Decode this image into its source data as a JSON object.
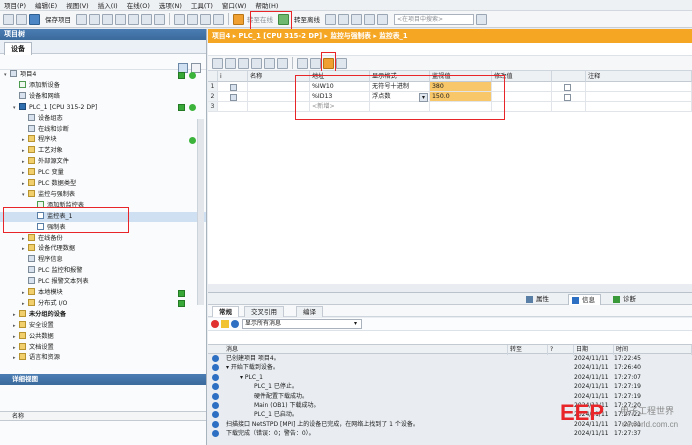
{
  "menubar": [
    "项目(P)",
    "编辑(E)",
    "视图(V)",
    "插入(I)",
    "在线(O)",
    "选项(N)",
    "工具(T)",
    "窗口(W)",
    "帮助(H)"
  ],
  "toolbar": {
    "save_label": "保存项目",
    "go_online_label": "转至在线",
    "go_offline_label": "转至离线",
    "search_placeholder": "<在项目中搜索>"
  },
  "left": {
    "header": "项目树",
    "tab": "设备",
    "tree": [
      {
        "label": "项目4",
        "indent": 0,
        "icon": "project",
        "twisty": "▾",
        "status": "check-dot"
      },
      {
        "label": "添加新设备",
        "indent": 1,
        "icon": "add"
      },
      {
        "label": "设备和网络",
        "indent": 1,
        "icon": "network"
      },
      {
        "label": "PLC_1 [CPU 315-2 DP]",
        "indent": 1,
        "icon": "cpu",
        "twisty": "▾",
        "status": "check-dot"
      },
      {
        "label": "设备组态",
        "indent": 2,
        "icon": "device"
      },
      {
        "label": "在线和诊断",
        "indent": 2,
        "icon": "diag"
      },
      {
        "label": "程序块",
        "indent": 2,
        "icon": "folder",
        "twisty": "▸",
        "status": "dot"
      },
      {
        "label": "工艺对象",
        "indent": 2,
        "icon": "folder",
        "twisty": "▸"
      },
      {
        "label": "外部源文件",
        "indent": 2,
        "icon": "folder",
        "twisty": "▸"
      },
      {
        "label": "PLC 变量",
        "indent": 2,
        "icon": "folder",
        "twisty": "▸"
      },
      {
        "label": "PLC 数据类型",
        "indent": 2,
        "icon": "folder",
        "twisty": "▸"
      },
      {
        "label": "监控与强制表",
        "indent": 2,
        "icon": "folder",
        "twisty": "▾"
      },
      {
        "label": "添加新监控表",
        "indent": 3,
        "icon": "add"
      },
      {
        "label": "监控表_1",
        "indent": 3,
        "icon": "table",
        "selected": true
      },
      {
        "label": "强制表",
        "indent": 3,
        "icon": "table"
      },
      {
        "label": "在线备份",
        "indent": 2,
        "icon": "folder",
        "twisty": "▸"
      },
      {
        "label": "设备代理数据",
        "indent": 2,
        "icon": "folder",
        "twisty": "▸"
      },
      {
        "label": "程序信息",
        "indent": 2,
        "icon": "info"
      },
      {
        "label": "PLC 监控和报警",
        "indent": 2,
        "icon": "alarm"
      },
      {
        "label": "PLC 报警文本列表",
        "indent": 2,
        "icon": "alarm"
      },
      {
        "label": "本地模块",
        "indent": 2,
        "icon": "folder",
        "twisty": "▸",
        "status": "check"
      },
      {
        "label": "分布式 I/O",
        "indent": 2,
        "icon": "folder",
        "twisty": "▸",
        "status": "check"
      },
      {
        "label": "未分组的设备",
        "indent": 1,
        "icon": "folder",
        "twisty": "▸",
        "bold": true
      },
      {
        "label": "安全设置",
        "indent": 1,
        "icon": "folder",
        "twisty": "▸"
      },
      {
        "label": "公共数据",
        "indent": 1,
        "icon": "folder",
        "twisty": "▸"
      },
      {
        "label": "文档设置",
        "indent": 1,
        "icon": "folder",
        "twisty": "▸"
      },
      {
        "label": "语言和资源",
        "indent": 1,
        "icon": "folder",
        "twisty": "▸"
      }
    ],
    "detail_header": "详细视图",
    "detail_column": "名称"
  },
  "editor": {
    "breadcrumb": "项目4 ▸ PLC_1 [CPU 315-2 DP] ▸ 监控与强制表 ▸ 监控表_1",
    "columns": [
      "i",
      "名称",
      "地址",
      "显示格式",
      "监视值",
      "修改值",
      "",
      "注释"
    ],
    "rows": [
      {
        "num": "1",
        "name": "",
        "address": "%IW10",
        "format": "无符号十进制",
        "monitor": "380",
        "modify": ""
      },
      {
        "num": "2",
        "name": "",
        "address": "%ID13",
        "format": "浮点数",
        "monitor": "150.0",
        "modify": ""
      },
      {
        "num": "3",
        "name": "",
        "address": "<新增>",
        "format": "",
        "monitor": "",
        "modify": ""
      }
    ]
  },
  "bottom": {
    "tabs": [
      "属性",
      "信息",
      "诊断"
    ],
    "sub_tabs": [
      "常规",
      "交叉引用",
      "编译"
    ],
    "filter_label": "显示所有消息",
    "columns": [
      "消息",
      "转至",
      "?",
      "日期",
      "时间"
    ],
    "messages": [
      {
        "indent": 0,
        "text": "已创建项目 项目4。",
        "date": "2024/11/11",
        "time": "17:22:45"
      },
      {
        "indent": 0,
        "text": "▾ 开始下载到设备。",
        "date": "2024/11/11",
        "time": "17:26:40"
      },
      {
        "indent": 1,
        "text": "▾ PLC_1",
        "date": "2024/11/11",
        "time": "17:27:07"
      },
      {
        "indent": 2,
        "text": "PLC_1 已停止。",
        "date": "2024/11/11",
        "time": "17:27:19"
      },
      {
        "indent": 2,
        "text": "硬件配置下载成功。",
        "date": "2024/11/11",
        "time": "17:27:19"
      },
      {
        "indent": 2,
        "text": "Main (OB1) 下载成功。",
        "date": "2024/11/11",
        "time": "17:27:20"
      },
      {
        "indent": 2,
        "text": "PLC_1 已启动。",
        "date": "2024/11/11",
        "time": "17:27:22"
      },
      {
        "indent": 0,
        "text": "扫描接口 NetSTPD [MPI] 上的设备已完成，在网络上找到了 1 个设备。",
        "date": "2024/11/11",
        "time": "17:27:31"
      },
      {
        "indent": 0,
        "text": "下载完成（错误：0；警告：0）。",
        "date": "2024/11/11",
        "time": "17:27:37"
      }
    ]
  },
  "watermark": {
    "brand": "EEP",
    "cn": "电子工程世界",
    "url": "eeworld.com.cn"
  },
  "colors": {
    "accent": "#f5a623",
    "header_blue": "#3b6a9c",
    "monitor_cell": "#f7c76a",
    "highlight": "#e8262a"
  }
}
